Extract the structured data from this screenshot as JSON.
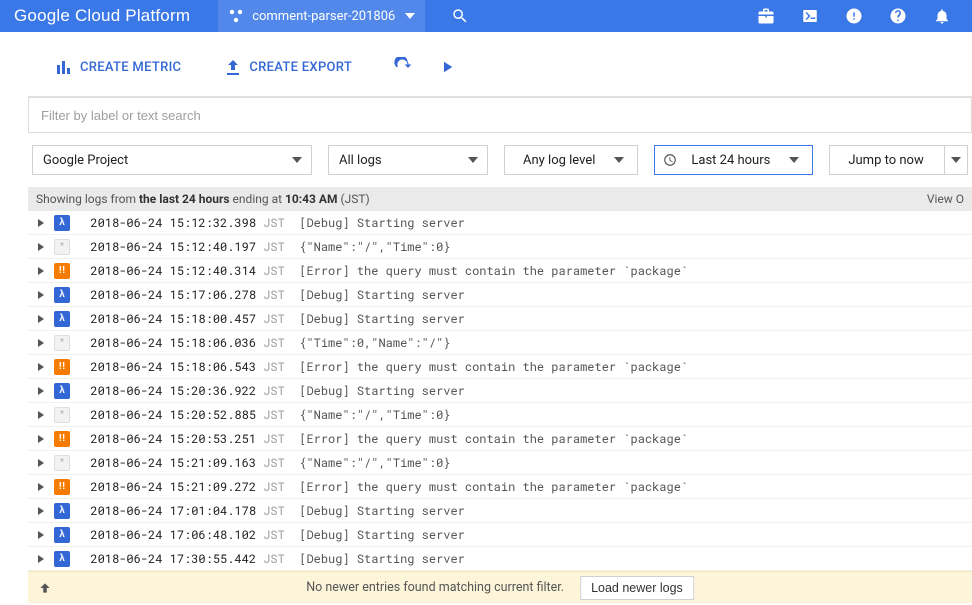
{
  "topbar": {
    "platform_name": "Google Cloud Platform",
    "project_name": "comment-parser-201806"
  },
  "actions": {
    "create_metric": "CREATE METRIC",
    "create_export": "CREATE EXPORT"
  },
  "filter": {
    "placeholder": "Filter by label or text search"
  },
  "dropdowns": {
    "resource": "Google Project",
    "log_name": "All logs",
    "severity": "Any log level",
    "time_range": "Last 24 hours",
    "jump": "Jump to now"
  },
  "status": {
    "prefix": "Showing logs from ",
    "bold1": "the last 24 hours",
    "mid": " ending at ",
    "bold2": "10:43 AM",
    "suffix": " (JST)",
    "view_options": "View O"
  },
  "logs": [
    {
      "sev": "debug",
      "ts": "2018-06-24 15:12:32.398",
      "tz": "JST",
      "tag": "[Debug]",
      "msg": "Starting server"
    },
    {
      "sev": "info",
      "ts": "2018-06-24 15:12:40.197",
      "tz": "JST",
      "tag": "",
      "msg": "{\"Name\":\"/\",\"Time\":0}"
    },
    {
      "sev": "error",
      "ts": "2018-06-24 15:12:40.314",
      "tz": "JST",
      "tag": "[Error]",
      "msg": "the query must contain the parameter `package`"
    },
    {
      "sev": "debug",
      "ts": "2018-06-24 15:17:06.278",
      "tz": "JST",
      "tag": "[Debug]",
      "msg": "Starting server"
    },
    {
      "sev": "debug",
      "ts": "2018-06-24 15:18:00.457",
      "tz": "JST",
      "tag": "[Debug]",
      "msg": "Starting server"
    },
    {
      "sev": "info",
      "ts": "2018-06-24 15:18:06.036",
      "tz": "JST",
      "tag": "",
      "msg": "{\"Time\":0,\"Name\":\"/\"}"
    },
    {
      "sev": "error",
      "ts": "2018-06-24 15:18:06.543",
      "tz": "JST",
      "tag": "[Error]",
      "msg": "the query must contain the parameter `package`"
    },
    {
      "sev": "debug",
      "ts": "2018-06-24 15:20:36.922",
      "tz": "JST",
      "tag": "[Debug]",
      "msg": "Starting server"
    },
    {
      "sev": "info",
      "ts": "2018-06-24 15:20:52.885",
      "tz": "JST",
      "tag": "",
      "msg": "{\"Name\":\"/\",\"Time\":0}"
    },
    {
      "sev": "error",
      "ts": "2018-06-24 15:20:53.251",
      "tz": "JST",
      "tag": "[Error]",
      "msg": "the query must contain the parameter `package`"
    },
    {
      "sev": "info",
      "ts": "2018-06-24 15:21:09.163",
      "tz": "JST",
      "tag": "",
      "msg": "{\"Name\":\"/\",\"Time\":0}"
    },
    {
      "sev": "error",
      "ts": "2018-06-24 15:21:09.272",
      "tz": "JST",
      "tag": "[Error]",
      "msg": "the query must contain the parameter `package`"
    },
    {
      "sev": "debug",
      "ts": "2018-06-24 17:01:04.178",
      "tz": "JST",
      "tag": "[Debug]",
      "msg": "Starting server"
    },
    {
      "sev": "debug",
      "ts": "2018-06-24 17:06:48.102",
      "tz": "JST",
      "tag": "[Debug]",
      "msg": "Starting server"
    },
    {
      "sev": "debug",
      "ts": "2018-06-24 17:30:55.442",
      "tz": "JST",
      "tag": "[Debug]",
      "msg": "Starting server"
    }
  ],
  "banner": {
    "message": "No newer entries found matching current filter.",
    "button": "Load newer logs"
  },
  "sev_glyph": {
    "debug": "λ",
    "info": "*",
    "error": "!!"
  }
}
